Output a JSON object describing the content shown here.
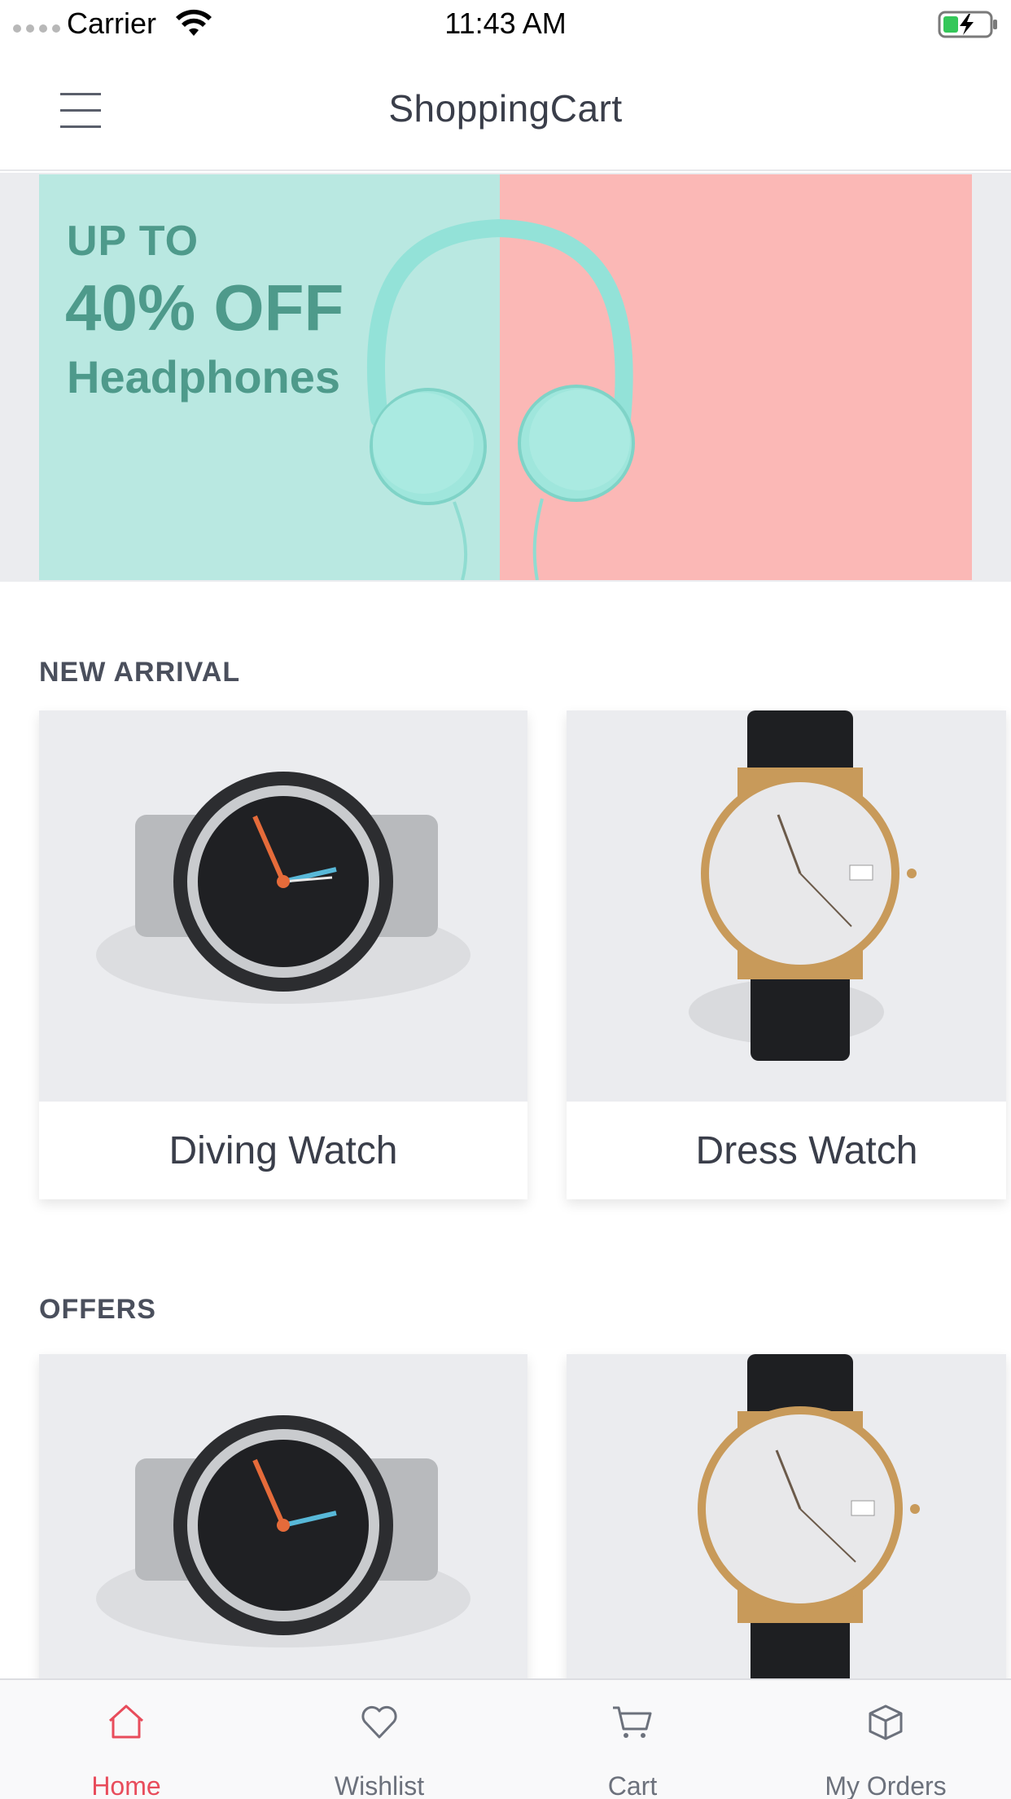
{
  "status_bar": {
    "carrier": "Carrier",
    "time": "11:43 AM"
  },
  "header": {
    "title": "ShoppingCart",
    "menu_icon": "hamburger-menu-icon"
  },
  "banner": {
    "line1": "UP TO",
    "line2": "40% OFF",
    "line3": "Headphones"
  },
  "sections": {
    "new_arrival": {
      "title": "NEW ARRIVAL",
      "items": [
        {
          "name": "Diving Watch"
        },
        {
          "name": "Dress Watch"
        }
      ]
    },
    "offers": {
      "title": "OFFERS"
    }
  },
  "tabbar": {
    "tabs": [
      {
        "label": "Home",
        "icon": "home-icon",
        "active": true
      },
      {
        "label": "Wishlist",
        "icon": "heart-icon"
      },
      {
        "label": "Cart",
        "icon": "cart-icon"
      },
      {
        "label": "My Orders",
        "icon": "box-icon"
      }
    ]
  },
  "colors": {
    "accent": "#e84c5b",
    "banner_teal": "#b9e8e1",
    "banner_pink": "#fbb8b6",
    "banner_text": "#4e9a8b"
  }
}
